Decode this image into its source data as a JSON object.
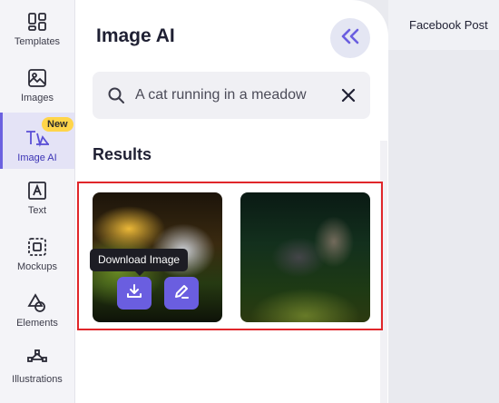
{
  "sidebar": {
    "items": [
      {
        "label": "Templates",
        "icon": "templates-icon"
      },
      {
        "label": "Images",
        "icon": "image-icon"
      },
      {
        "label": "Image AI",
        "icon": "image-ai-icon",
        "badge": "New",
        "active": true
      },
      {
        "label": "Text",
        "icon": "text-icon"
      },
      {
        "label": "Mockups",
        "icon": "mockups-icon"
      },
      {
        "label": "Elements",
        "icon": "elements-icon"
      },
      {
        "label": "Illustrations",
        "icon": "illustrations-icon"
      }
    ]
  },
  "panel": {
    "title": "Image AI",
    "collapse_icon": "double-chevron-left-icon",
    "search": {
      "value": "A cat running in a meadow",
      "search_icon": "search-icon",
      "clear_icon": "close-icon"
    },
    "results_title": "Results",
    "results": [
      {
        "tooltip": "Download Image",
        "actions": [
          "download-icon",
          "edit-icon"
        ]
      },
      {}
    ]
  },
  "canvas": {
    "title": "Facebook Post"
  },
  "colors": {
    "accent": "#6a5ee0",
    "highlight_border": "#e0262a",
    "badge": "#ffd54a"
  }
}
